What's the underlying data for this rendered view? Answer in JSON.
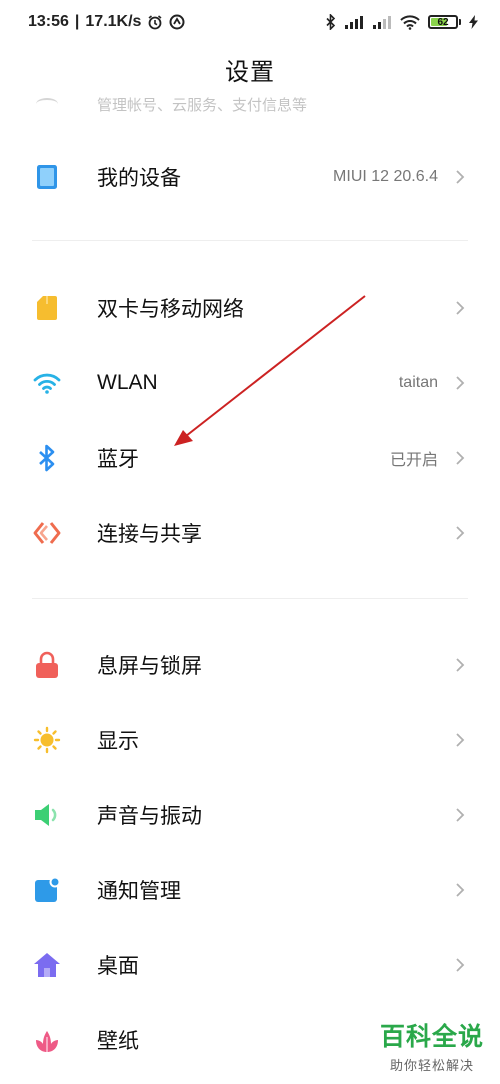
{
  "status_bar": {
    "time": "13:56",
    "separator": "|",
    "net_speed": "17.1K/s",
    "battery": "62"
  },
  "title": "设置",
  "faded_row_text": "管理帐号、云服务、支付信息等",
  "rows": [
    {
      "label": "我的设备",
      "value": "MIUI 12 20.6.4",
      "icon": "device-icon",
      "color": "#2f95e8"
    },
    {
      "label": "双卡与移动网络",
      "value": "",
      "icon": "sim-card-icon",
      "color": "#f6bd2f"
    },
    {
      "label": "WLAN",
      "value": "taitan",
      "icon": "wifi-icon",
      "color": "#27b2e6"
    },
    {
      "label": "蓝牙",
      "value": "已开启",
      "icon": "bluetooth-icon",
      "color": "#2c8ff0"
    },
    {
      "label": "连接与共享",
      "value": "",
      "icon": "connection-share-icon",
      "color": "#ef6c4e"
    },
    {
      "label": "息屏与锁屏",
      "value": "",
      "icon": "lock-icon",
      "color": "#f0605a"
    },
    {
      "label": "显示",
      "value": "",
      "icon": "sun-icon",
      "color": "#f7be2c"
    },
    {
      "label": "声音与振动",
      "value": "",
      "icon": "speaker-icon",
      "color": "#3ccf74"
    },
    {
      "label": "通知管理",
      "value": "",
      "icon": "notification-icon",
      "color": "#2e9ae8"
    },
    {
      "label": "桌面",
      "value": "",
      "icon": "home-icon",
      "color": "#7b6cf0"
    },
    {
      "label": "壁纸",
      "value": "",
      "icon": "wallpaper-flower-icon",
      "color": "#ee5a86"
    }
  ],
  "watermark": {
    "title": "百科全说",
    "subtitle": "助你轻松解决"
  },
  "annotation_arrow_color": "#cc2222"
}
